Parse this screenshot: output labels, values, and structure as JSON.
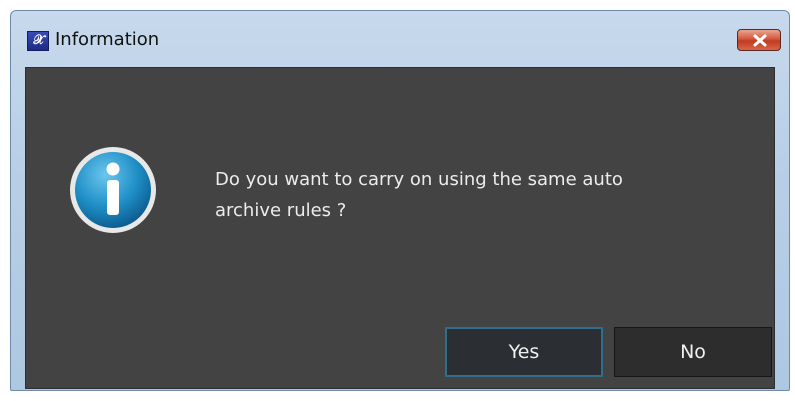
{
  "window": {
    "title": "Information",
    "app_icon": "app-logo-icon",
    "close_icon": "close-icon"
  },
  "dialog": {
    "icon": "info-icon",
    "message_line1": "Do you want to carry on using the same auto",
    "message_line2": "archive rules ?",
    "buttons": {
      "yes_label": "Yes",
      "no_label": "No"
    }
  },
  "colors": {
    "client_background": "#434343",
    "button_background": "#2d2d2d",
    "focused_button_border": "#2f6f89",
    "info_icon_blue": "#1f8fc6",
    "close_button_red": "#c13b20"
  }
}
